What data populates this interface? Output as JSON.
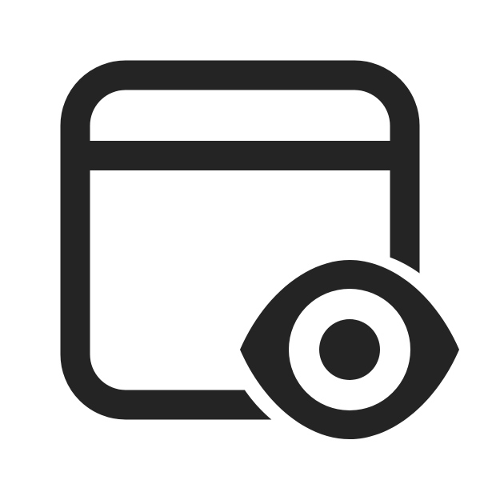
{
  "icon": {
    "name": "window-eye-icon",
    "parts": [
      "window-icon",
      "eye-icon"
    ],
    "colors": {
      "foreground": "#242424",
      "background": "#ffffff"
    }
  }
}
